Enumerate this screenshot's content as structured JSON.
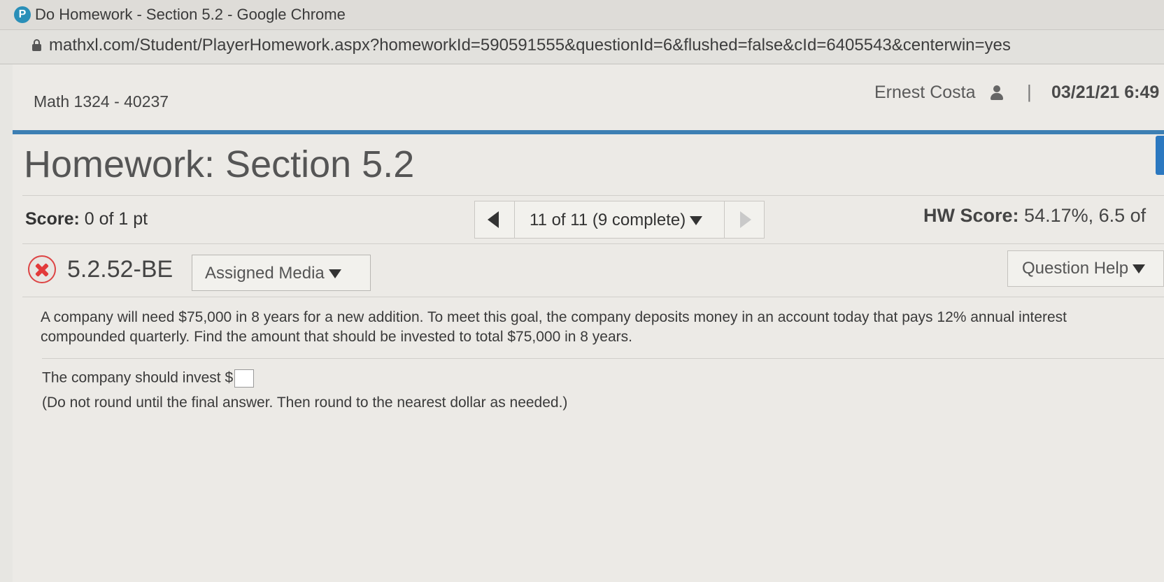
{
  "browser": {
    "window_title": "Do Homework - Section 5.2 - Google Chrome",
    "url": "mathxl.com/Student/PlayerHomework.aspx?homeworkId=590591555&questionId=6&flushed=false&cId=6405543&centerwin=yes"
  },
  "header": {
    "course": "Math 1324 - 40237",
    "user_name": "Ernest Costa",
    "separator": "|",
    "date": "03/21/21 6:49"
  },
  "homework": {
    "title": "Homework: Section 5.2",
    "score_label": "Score:",
    "score_value": "0 of 1 pt",
    "nav_label": "11 of 11 (9 complete)",
    "hw_score_label": "HW Score:",
    "hw_score_value": "54.17%, 6.5 of"
  },
  "question": {
    "id": "5.2.52-BE",
    "assigned_media_label": "Assigned Media",
    "question_help_label": "Question Help",
    "problem_text": "A company will need $75,000 in 8 years for a new addition. To meet this goal, the company deposits money in an account today that pays 12% annual interest compounded quarterly. Find the amount that should be invested to total $75,000 in 8 years.",
    "answer_prefix": "The company should invest $",
    "answer_value": "",
    "hint": "(Do not round until the final answer. Then round to the nearest dollar as needed.)"
  },
  "colors": {
    "accent_blue": "#3d7fb3",
    "incorrect_red": "#e23a3a"
  },
  "icons": {
    "app_logo": "pearson-p-icon",
    "lock": "lock-icon",
    "user": "user-icon",
    "incorrect": "x-circle-icon",
    "prev": "triangle-left-icon",
    "next": "triangle-right-icon",
    "dropdown": "triangle-down-icon"
  }
}
